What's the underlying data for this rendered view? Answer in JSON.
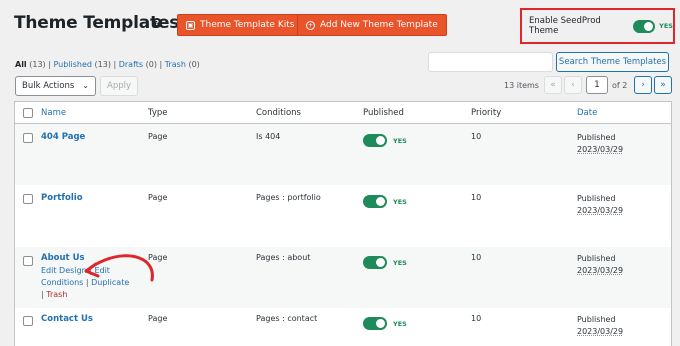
{
  "header": {
    "title": "Theme Templates",
    "help_glyph": "?",
    "kits_button": "Theme Template Kits",
    "add_button": "Add New Theme Template",
    "enable_label": "Enable SeedProd Theme",
    "enable_state": "YES"
  },
  "filters": {
    "all": "All",
    "all_count": "(13)",
    "published": "Published",
    "published_count": "(13)",
    "drafts": "Drafts",
    "drafts_count": "(0)",
    "trash": "Trash",
    "trash_count": "(0)",
    "sep": "|"
  },
  "search": {
    "placeholder": "",
    "button": "Search Theme Templates"
  },
  "bulk": {
    "selected": "Bulk Actions",
    "apply": "Apply"
  },
  "pagination": {
    "items": "13 items",
    "first": "«",
    "prev": "‹",
    "current": "1",
    "of": "of 2",
    "next": "›",
    "last": "»"
  },
  "columns": {
    "name": "Name",
    "type": "Type",
    "conditions": "Conditions",
    "published": "Published",
    "priority": "Priority",
    "date": "Date"
  },
  "rows": [
    {
      "name": "404 Page",
      "type": "Page",
      "conditions": "Is 404",
      "published": "YES",
      "priority": "10",
      "date_status": "Published",
      "date": "2023/03/29"
    },
    {
      "name": "Portfolio",
      "type": "Page",
      "conditions": "Pages : portfolio",
      "published": "YES",
      "priority": "10",
      "date_status": "Published",
      "date": "2023/03/29"
    },
    {
      "name": "About Us",
      "type": "Page",
      "conditions": "Pages : about",
      "published": "YES",
      "priority": "10",
      "date_status": "Published",
      "date": "2023/03/29",
      "actions": {
        "edit_design": "Edit Design",
        "edit": "Edit",
        "conditions": "Conditions",
        "duplicate": "Duplicate",
        "trash": "Trash",
        "sep": "|"
      }
    },
    {
      "name": "Contact Us",
      "type": "Page",
      "conditions": "Pages : contact",
      "published": "YES",
      "priority": "10",
      "date_status": "Published",
      "date": "2023/03/29"
    }
  ],
  "colors": {
    "accent": "#e9542b",
    "link": "#2271b1",
    "toggle_on": "#1f8a5a",
    "highlight": "#e0262b"
  }
}
